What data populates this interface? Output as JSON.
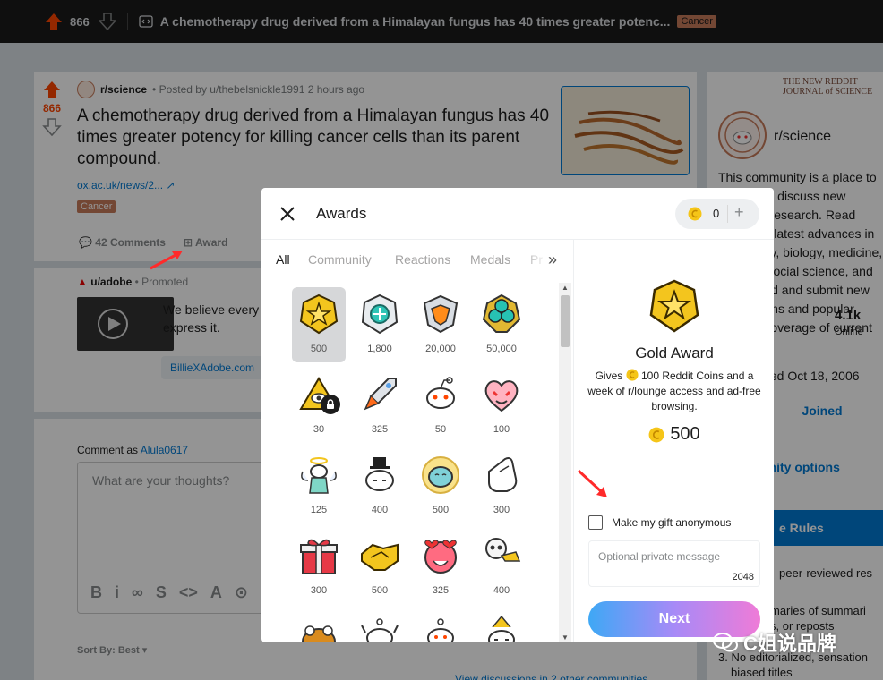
{
  "topbar": {
    "vote_count": "866",
    "title": "A chemotherapy drug derived from a Himalayan fungus has 40 times greater potenc...",
    "flair": "Cancer"
  },
  "post": {
    "vote_count": "866",
    "subreddit": "r/science",
    "posted_by": "• Posted by u/thebelsnickle1991 2 hours ago",
    "title": "A chemotherapy drug derived from a Himalayan fungus has 40 times greater potency for killing cancer cells than its parent compound.",
    "link": "ox.ac.uk/news/2...",
    "flair": "Cancer",
    "comments_label": "42 Comments",
    "award_label": "Award"
  },
  "promo": {
    "user": "u/adobe",
    "promoted": "• Promoted",
    "text": "We believe every express it.",
    "link": "BillieXAdobe.com"
  },
  "comment": {
    "as_label": "Comment as",
    "username": "Alula0617",
    "placeholder": "What are your thoughts?",
    "tools": [
      "B",
      "i",
      "∞",
      "S",
      "<>",
      "A",
      "⊙"
    ],
    "sort_label": "Sort By: Best",
    "view_discussions": "View discussions in 2 other communities"
  },
  "sidebar": {
    "journal": "THE NEW REDDIT JOURNAL of SCIENCE",
    "name": "r/science",
    "description": "This community is a place to share and discuss new scientific research. Read about the latest advances in astronomy, biology, medicine, physics, social science, and more. Find and submit new publications and popular science coverage of current research.",
    "online_count": "4.1k",
    "online_label": "Online",
    "created": "ted Oct 18, 2006",
    "joined": "Joined",
    "options": "unity options",
    "rules_header": "e Rules",
    "rules": [
      "peer-reviewed res",
      "maries of summari",
      "s, or reposts",
      "3. No editorialized, sensation",
      "biased titles"
    ]
  },
  "modal": {
    "title": "Awards",
    "coin_balance": "0",
    "plus": "+",
    "tabs": [
      "All",
      "Community",
      "Reactions",
      "Medals",
      "Pr"
    ],
    "more": "»",
    "awards": [
      {
        "price": "500",
        "icon": "gold-award-icon",
        "selected": true
      },
      {
        "price": "1,800",
        "icon": "platinum-award-icon"
      },
      {
        "price": "20,000",
        "icon": "ternion-award-icon"
      },
      {
        "price": "50,000",
        "icon": "argentium-award-icon"
      },
      {
        "price": "30",
        "icon": "illuminati-award-icon",
        "locked": true
      },
      {
        "price": "325",
        "icon": "rocket-like-icon"
      },
      {
        "price": "50",
        "icon": "snoo-award-icon"
      },
      {
        "price": "100",
        "icon": "heart-eyes-icon"
      },
      {
        "price": "125",
        "icon": "angel-snoo-icon"
      },
      {
        "price": "400",
        "icon": "tophat-snoo-icon"
      },
      {
        "price": "500",
        "icon": "blessed-ghost-icon"
      },
      {
        "price": "300",
        "icon": "pointing-hand-icon"
      },
      {
        "price": "300",
        "icon": "gift-box-icon"
      },
      {
        "price": "500",
        "icon": "handshake-icon"
      },
      {
        "price": "325",
        "icon": "heart-face-icon"
      },
      {
        "price": "400",
        "icon": "skull-trumpet-icon"
      },
      {
        "price": "",
        "icon": "frog-award-icon"
      },
      {
        "price": "",
        "icon": "snoo-arms-icon"
      },
      {
        "price": "",
        "icon": "snoo-cheer-icon"
      },
      {
        "price": "",
        "icon": "snoo-party-icon"
      }
    ],
    "selected": {
      "name": "Gold Award",
      "desc_prefix": "Gives",
      "desc_suffix": "100 Reddit Coins and a week of r/lounge access and ad-free browsing.",
      "price": "500"
    },
    "anonymous_label": "Make my gift anonymous",
    "message_placeholder": "Optional private message",
    "message_limit": "2048",
    "next_label": "Next"
  },
  "watermark": "C姐说品牌",
  "colors": {
    "reddit_orange": "#ff4500",
    "link_blue": "#0079d3",
    "coin_gold": "#f5c518",
    "flair": "#c77a5a"
  }
}
